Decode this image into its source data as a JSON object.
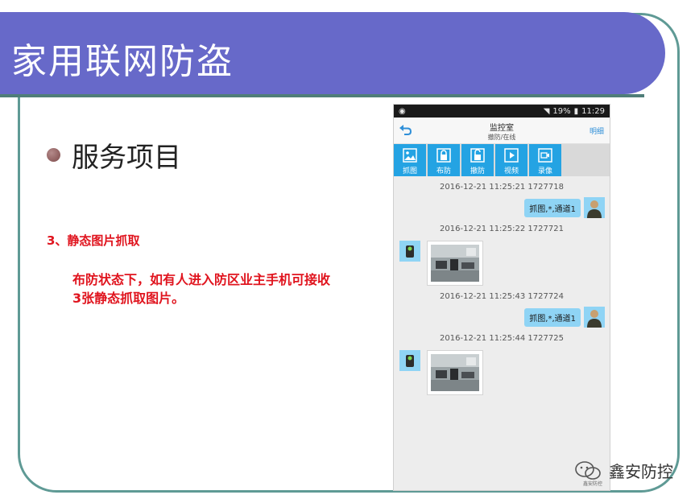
{
  "slide": {
    "title": "家用联网防盗",
    "bullet": "服务项目",
    "section_heading": "3、静态图片抓取",
    "description": "布防状态下，如有人进入防区业主手机可接收3张静态抓取图片。"
  },
  "phone": {
    "status_right": "19%",
    "time": "11:29",
    "header_title": "监控室",
    "header_subtitle": "撤防/在线",
    "detail_link": "明细",
    "toolbar": [
      {
        "label": "抓图",
        "icon": "image-icon"
      },
      {
        "label": "布防",
        "icon": "lock-closed-icon"
      },
      {
        "label": "撤防",
        "icon": "lock-open-icon"
      },
      {
        "label": "视频",
        "icon": "play-icon"
      },
      {
        "label": "录像",
        "icon": "camera-icon"
      }
    ],
    "messages": [
      {
        "timestamp": "2016-12-21 11:25:21 1727718",
        "outgoing": "抓图,*,通道1"
      },
      {
        "timestamp": "2016-12-21 11:25:22 1727721",
        "incoming": "photo"
      },
      {
        "timestamp": "2016-12-21 11:25:43 1727724",
        "outgoing": "抓图,*,通道1"
      },
      {
        "timestamp": "2016-12-21 11:25:44 1727725",
        "incoming": "photo"
      }
    ]
  },
  "watermark": {
    "brand": "鑫安防控",
    "small": "鑫安防控"
  },
  "colors": {
    "title_bar": "#6769c9",
    "frame": "#5f9a95",
    "accent_red": "#e0141e",
    "toolbar_blue": "#24a3e3",
    "bubble": "#8fd4f5"
  }
}
